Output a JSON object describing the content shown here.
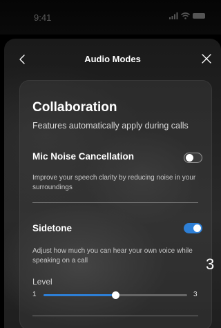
{
  "status_bar": {
    "time": "9:41",
    "icons": [
      "signal-icon",
      "wifi-icon",
      "battery-icon"
    ]
  },
  "nav": {
    "title": "Audio Modes",
    "back_icon": "chevron-left-icon",
    "close_icon": "close-icon"
  },
  "card": {
    "title": "Collaboration",
    "subtitle": "Features automatically apply during calls",
    "mic_noise": {
      "label": "Mic Noise Cancellation",
      "description": "Improve your speech clarity by reducing noise in your surroundings",
      "enabled": false
    },
    "sidetone": {
      "label": "Sidetone",
      "description": "Adjust how much you can hear your own voice while speaking on a call",
      "enabled": true,
      "level_label": "Level",
      "min_label": "1",
      "max_label": "3",
      "level_fraction": 0.5
    }
  },
  "stray_glyph": "3",
  "colors": {
    "accent": "#2d7fd6",
    "background": "#000000"
  }
}
